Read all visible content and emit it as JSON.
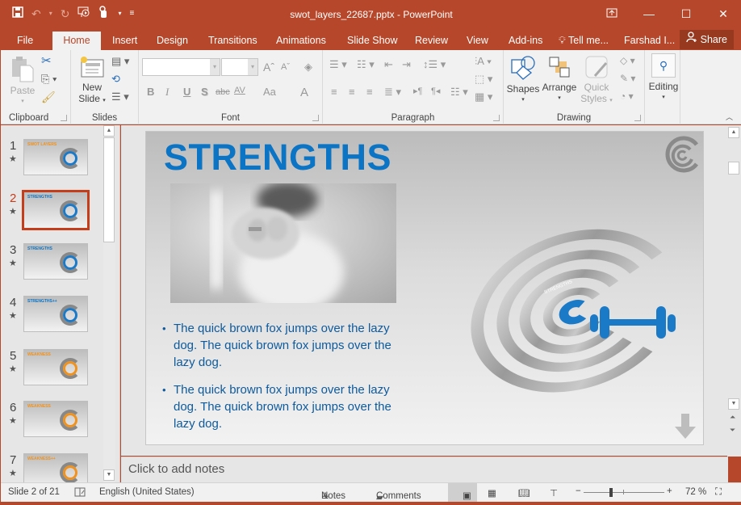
{
  "window": {
    "title": "swot_layers_22687.pptx - PowerPoint",
    "controls": [
      "ribbon-display-options",
      "minimize",
      "maximize",
      "close"
    ]
  },
  "quick_access": [
    "save-icon",
    "undo-icon",
    "redo-icon",
    "start-from-beginning-icon",
    "touch-mode-icon",
    "customize-qat-icon"
  ],
  "tabs": [
    {
      "label": "File",
      "active": false
    },
    {
      "label": "Home",
      "active": true
    },
    {
      "label": "Insert",
      "active": false
    },
    {
      "label": "Design",
      "active": false
    },
    {
      "label": "Transitions",
      "active": false
    },
    {
      "label": "Animations",
      "active": false
    },
    {
      "label": "Slide Show",
      "active": false
    },
    {
      "label": "Review",
      "active": false
    },
    {
      "label": "View",
      "active": false
    },
    {
      "label": "Add-ins",
      "active": false
    }
  ],
  "tell_me": "Tell me...",
  "user": "Farshad I...",
  "share": "Share",
  "ribbon": {
    "clipboard": {
      "label": "Clipboard",
      "paste": "Paste"
    },
    "slides": {
      "label": "Slides",
      "new_slide_1": "New",
      "new_slide_2": "Slide"
    },
    "font": {
      "label": "Font",
      "font_name": "",
      "font_size": "",
      "bold": "B",
      "italic": "I",
      "underline": "U",
      "shadow": "S",
      "strike": "abc",
      "spacing": "AV",
      "case": "Aa",
      "color": "A"
    },
    "paragraph": {
      "label": "Paragraph"
    },
    "drawing": {
      "label": "Drawing",
      "shapes": "Shapes",
      "arrange": "Arrange",
      "quick_styles_1": "Quick",
      "quick_styles_2": "Styles"
    },
    "editing": {
      "label": "Editing"
    }
  },
  "thumbnails": [
    {
      "num": "1",
      "title": "SWOT LAYERS",
      "selected": false
    },
    {
      "num": "2",
      "title": "STRENGTHS",
      "selected": true
    },
    {
      "num": "3",
      "title": "STRENGTHS",
      "selected": false
    },
    {
      "num": "4",
      "title": "STRENGTHS++",
      "selected": false
    },
    {
      "num": "5",
      "title": "WEAKNESS",
      "selected": false
    },
    {
      "num": "6",
      "title": "WEAKNESS",
      "selected": false
    },
    {
      "num": "7",
      "title": "WEAKNESS++",
      "selected": false
    }
  ],
  "slide": {
    "title": "STRENGTHS",
    "bullets": [
      "The quick brown fox jumps over the lazy dog. The quick brown fox jumps over the lazy dog.",
      "The quick brown fox jumps over the lazy dog. The quick brown fox jumps over the lazy dog."
    ],
    "ring_label": "STRENGTHS",
    "colors": {
      "title": "#0b74c4",
      "body": "#0d5a9c",
      "accent": "#1b7ac8"
    }
  },
  "notes_placeholder": "Click to add notes",
  "status": {
    "slide_info": "Slide 2 of 21",
    "language": "English (United States)",
    "notes": "Notes",
    "comments": "Comments",
    "zoom": "72 %",
    "zoom_fraction": 0.72
  },
  "theme": {
    "accent": "#b7472a"
  }
}
